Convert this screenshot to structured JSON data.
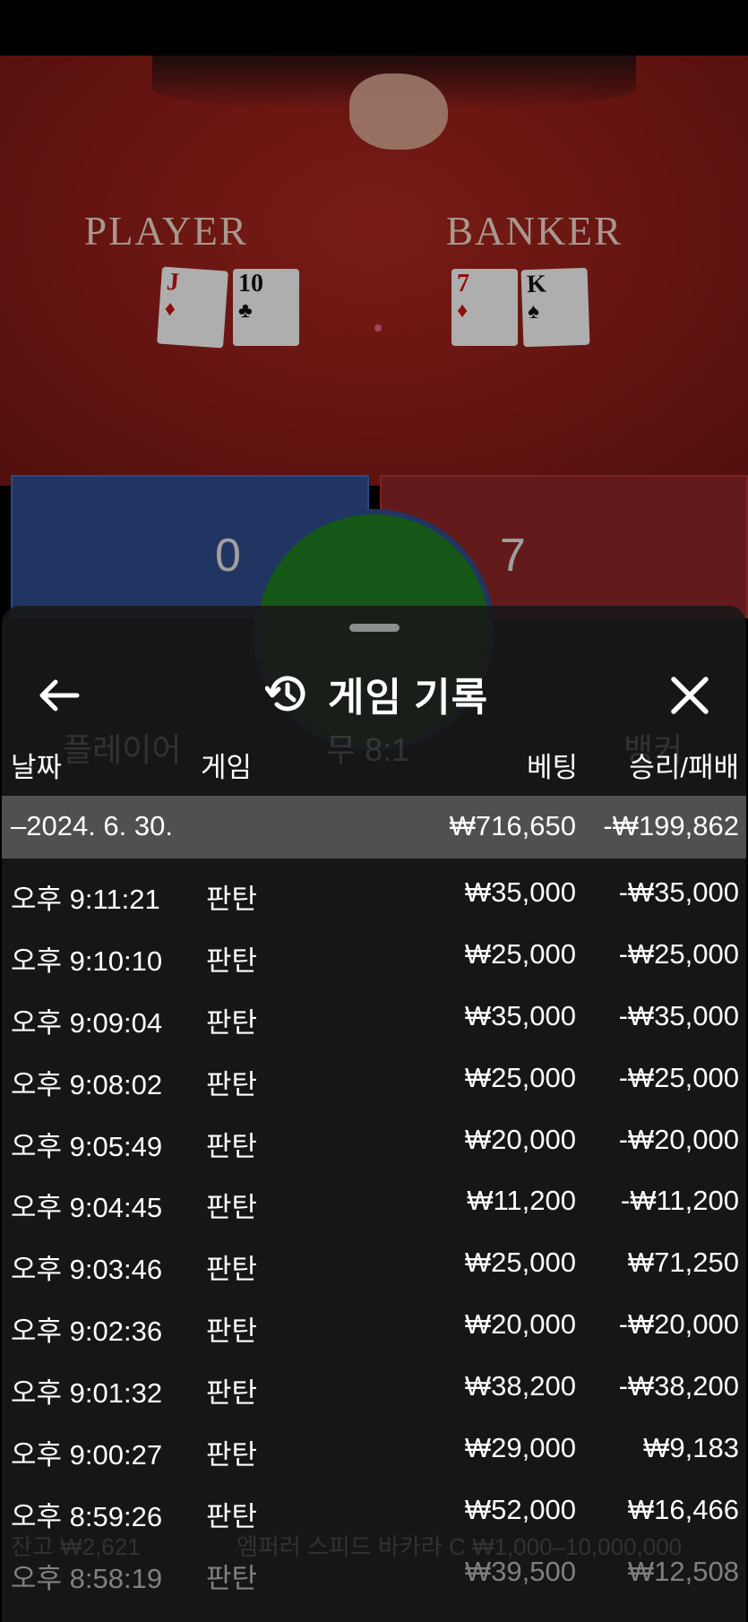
{
  "table": {
    "player_label": "PLAYER",
    "banker_label": "BANKER",
    "player_cards": [
      {
        "rank": "J",
        "suit": "♦",
        "color": "#c41414"
      },
      {
        "rank": "10",
        "suit": "♣",
        "color": "#111111"
      }
    ],
    "banker_cards": [
      {
        "rank": "7",
        "suit": "♦",
        "color": "#c41414"
      },
      {
        "rank": "K",
        "suit": "♠",
        "color": "#111111"
      }
    ],
    "player_score": "0",
    "banker_score": "7"
  },
  "sheet": {
    "title": "게임 기록",
    "icons": {
      "back": "arrow-left-icon",
      "history": "history-icon",
      "close": "close-icon"
    },
    "columns": {
      "date": "날짜",
      "game": "게임",
      "bet": "베팅",
      "win_loss": "승리/패배"
    },
    "summary": {
      "date": "–2024. 6. 30.",
      "bet": "₩716,650",
      "win_loss": "-₩199,862"
    },
    "rows": [
      {
        "time": "오후 9:11:21",
        "game": "판탄",
        "bet": "₩35,000",
        "win_loss": "-₩35,000"
      },
      {
        "time": "오후 9:10:10",
        "game": "판탄",
        "bet": "₩25,000",
        "win_loss": "-₩25,000"
      },
      {
        "time": "오후 9:09:04",
        "game": "판탄",
        "bet": "₩35,000",
        "win_loss": "-₩35,000"
      },
      {
        "time": "오후 9:08:02",
        "game": "판탄",
        "bet": "₩25,000",
        "win_loss": "-₩25,000"
      },
      {
        "time": "오후 9:05:49",
        "game": "판탄",
        "bet": "₩20,000",
        "win_loss": "-₩20,000"
      },
      {
        "time": "오후 9:04:45",
        "game": "판탄",
        "bet": "₩11,200",
        "win_loss": "-₩11,200"
      },
      {
        "time": "오후 9:03:46",
        "game": "판탄",
        "bet": "₩25,000",
        "win_loss": "₩71,250"
      },
      {
        "time": "오후 9:02:36",
        "game": "판탄",
        "bet": "₩20,000",
        "win_loss": "-₩20,000"
      },
      {
        "time": "오후 9:01:32",
        "game": "판탄",
        "bet": "₩38,200",
        "win_loss": "-₩38,200"
      },
      {
        "time": "오후 9:00:27",
        "game": "판탄",
        "bet": "₩29,000",
        "win_loss": "₩9,183"
      },
      {
        "time": "오후 8:59:26",
        "game": "판탄",
        "bet": "₩52,000",
        "win_loss": "₩16,466"
      },
      {
        "time": "오후 8:58:19",
        "game": "판탄",
        "bet": "₩39,500",
        "win_loss": "₩12,508"
      }
    ]
  },
  "background_ghost_text": {
    "player_bet": "플레이어",
    "tie_bet": "무 8:1",
    "banker_bet": "뱅커",
    "balance": "잔고 ₩2,621",
    "table_name": "엠퍼러 스피드 바카라 C ₩1,000–10,000,000"
  },
  "colors": {
    "felt": "#8c1d18",
    "player_blue": "#2f4a8a",
    "banker_red": "#8a2424",
    "tie_green": "#1e7a21",
    "sheet_bg": "#181818",
    "summary_bg": "#505050"
  }
}
